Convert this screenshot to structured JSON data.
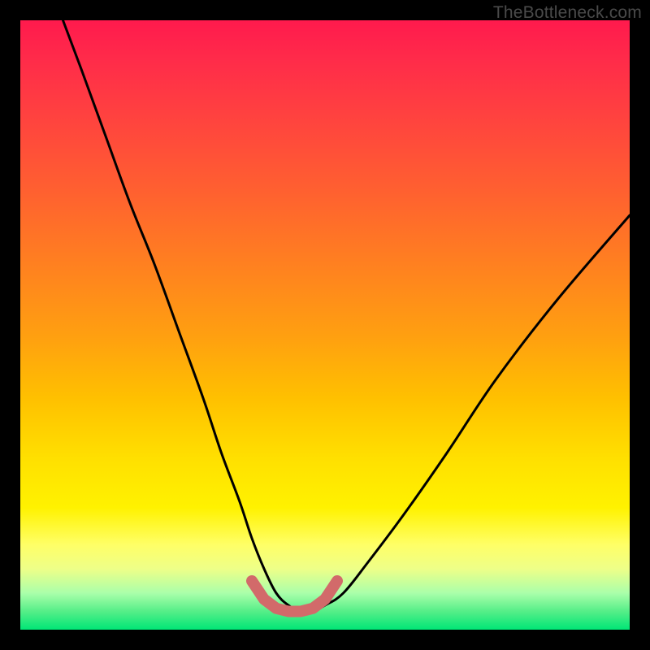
{
  "watermark": "TheBottleneck.com",
  "chart_data": {
    "type": "line",
    "title": "",
    "xlabel": "",
    "ylabel": "",
    "xlim": [
      0,
      100
    ],
    "ylim": [
      0,
      100
    ],
    "grid": false,
    "series": [
      {
        "name": "main-curve",
        "color": "#000000",
        "x": [
          7,
          10,
          14,
          18,
          22,
          26,
          30,
          33,
          36,
          38,
          40,
          42,
          44,
          46,
          48,
          50,
          53,
          57,
          63,
          70,
          78,
          88,
          100
        ],
        "y": [
          100,
          92,
          81,
          70,
          60,
          49,
          38,
          29,
          21,
          15,
          10,
          6,
          4,
          3,
          3,
          4,
          6,
          11,
          19,
          29,
          41,
          54,
          68
        ]
      },
      {
        "name": "bottom-marker",
        "color": "#d26a6a",
        "x": [
          38,
          40,
          42,
          44,
          46,
          48,
          50,
          52
        ],
        "y": [
          8,
          5,
          3.5,
          3,
          3,
          3.5,
          5,
          8
        ]
      }
    ],
    "gradient_stops": [
      {
        "pos": 0.0,
        "color": "#ff1a4d"
      },
      {
        "pos": 0.28,
        "color": "#ff6030"
      },
      {
        "pos": 0.62,
        "color": "#ffc000"
      },
      {
        "pos": 0.86,
        "color": "#ffff66"
      },
      {
        "pos": 1.0,
        "color": "#00e676"
      }
    ]
  }
}
